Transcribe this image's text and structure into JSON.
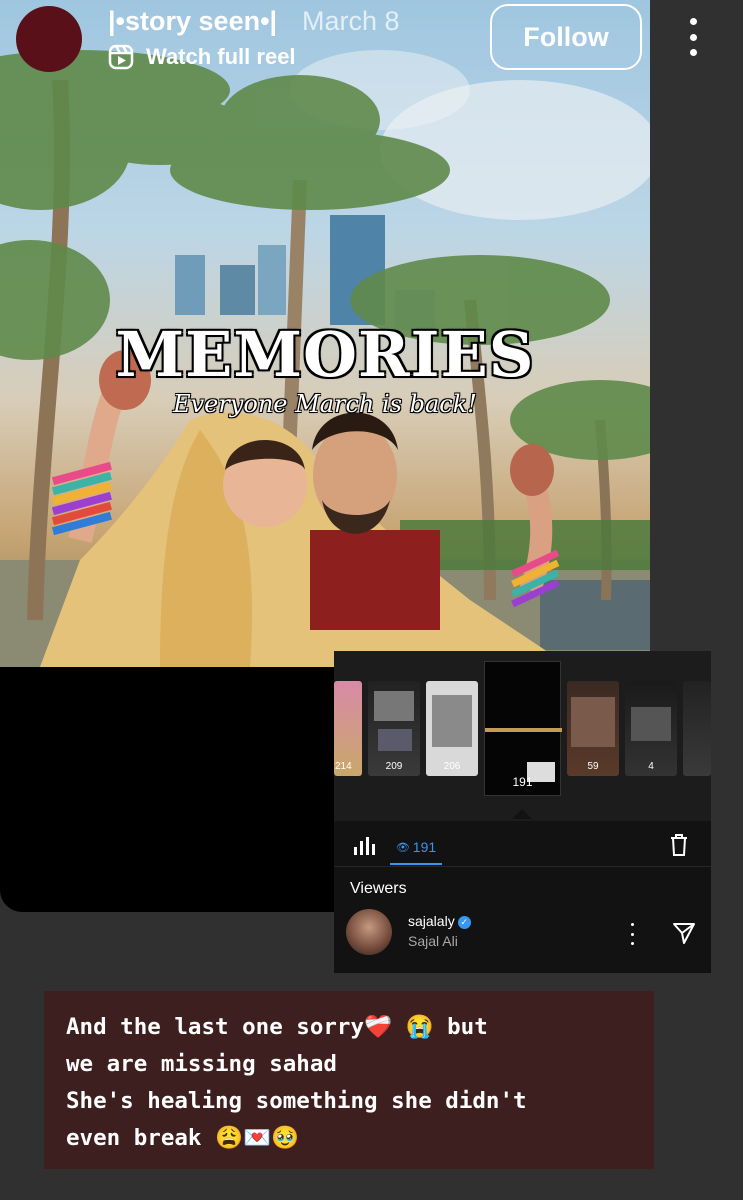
{
  "header": {
    "username": "|•story seen•|",
    "date": "March 8",
    "reel_label": "Watch full reel",
    "follow_label": "Follow",
    "more_icon": "more-vertical-icon",
    "reel_icon": "reels-icon"
  },
  "poster": {
    "title": "MEMORIES",
    "subtitle": "Everyone March is back!"
  },
  "insights": {
    "thumbnails": [
      {
        "count": "214"
      },
      {
        "count": "209"
      },
      {
        "count": "206"
      },
      {
        "count": "191",
        "selected": true
      },
      {
        "count": "59"
      },
      {
        "count": "4"
      }
    ],
    "views_count": "191",
    "viewers_label": "Viewers",
    "viewer": {
      "handle": "sajalaly",
      "name": "Sajal Ali",
      "verified": true
    },
    "accent_color": "#3797f0"
  },
  "caption": {
    "lines": [
      "And the last one sorry❤️‍🩹 😭 but",
      "we are missing sahad",
      "She's healing something she didn't",
      "even break 😩💌🥹"
    ]
  }
}
